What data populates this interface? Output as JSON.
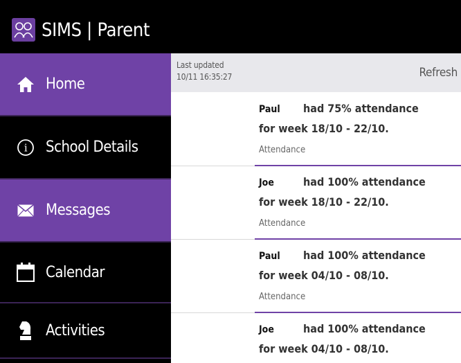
{
  "app": {
    "title": "SIMS | Parent",
    "logo_icon": "people-logo-icon",
    "accent_color": "#6f42a6"
  },
  "sidebar": {
    "items": [
      {
        "label": "Home",
        "icon": "home-icon",
        "active": true
      },
      {
        "label": "School Details",
        "icon": "info-icon",
        "active": false
      },
      {
        "label": "Messages",
        "icon": "envelope-icon",
        "active": true
      },
      {
        "label": "Calendar",
        "icon": "calendar-icon",
        "active": false
      },
      {
        "label": "Activities",
        "icon": "chess-knight-icon",
        "active": false
      }
    ]
  },
  "status": {
    "last_updated_label": "Last updated",
    "last_updated_value": "10/11 16:35:27",
    "refresh_label": "Refresh"
  },
  "messages": [
    {
      "name": "Paul",
      "text": "had 75% attendance",
      "period": "for week 18/10 - 22/10.",
      "category": "Attendance"
    },
    {
      "name": "Joe",
      "text": "had 100% attendance",
      "period": "for week 18/10 - 22/10.",
      "category": "Attendance"
    },
    {
      "name": "Paul",
      "text": "had 100% attendance",
      "period": "for week 04/10 - 08/10.",
      "category": "Attendance"
    },
    {
      "name": "Joe",
      "text": "had 100% attendance",
      "period": "for week 04/10 - 08/10.",
      "category": "Attendance"
    }
  ]
}
